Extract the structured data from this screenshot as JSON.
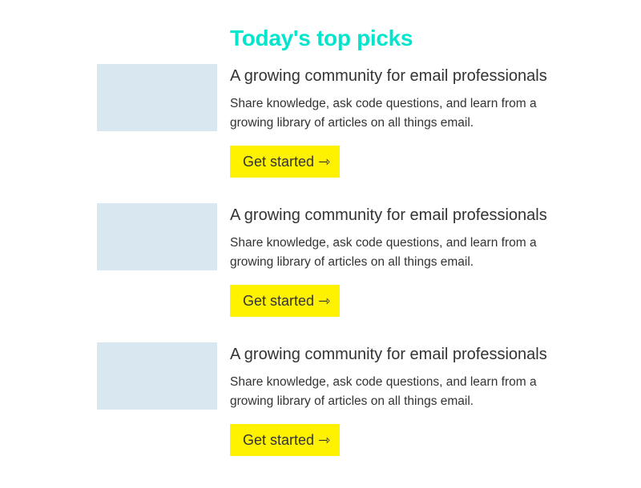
{
  "page": {
    "title": "Today's top picks",
    "colors": {
      "title": "#00e5cc",
      "thumbnail": "#d9e7f0",
      "button": "#fff200",
      "text": "#333333"
    }
  },
  "cards": [
    {
      "heading": "A growing community for email professionals",
      "text": "Share knowledge, ask code questions, and learn from a growing library of articles on all things email.",
      "button": "Get started ⇾",
      "thumbnail": "image-placeholder"
    },
    {
      "heading": "A growing community for email professionals",
      "text": "Share knowledge, ask code questions, and learn from a growing library of articles on all things email.",
      "button": "Get started ⇾",
      "thumbnail": "image-placeholder"
    },
    {
      "heading": "A growing community for email professionals",
      "text": "Share knowledge, ask code questions, and learn from a growing library of articles on all things email.",
      "button": "Get started ⇾",
      "thumbnail": "image-placeholder"
    }
  ]
}
